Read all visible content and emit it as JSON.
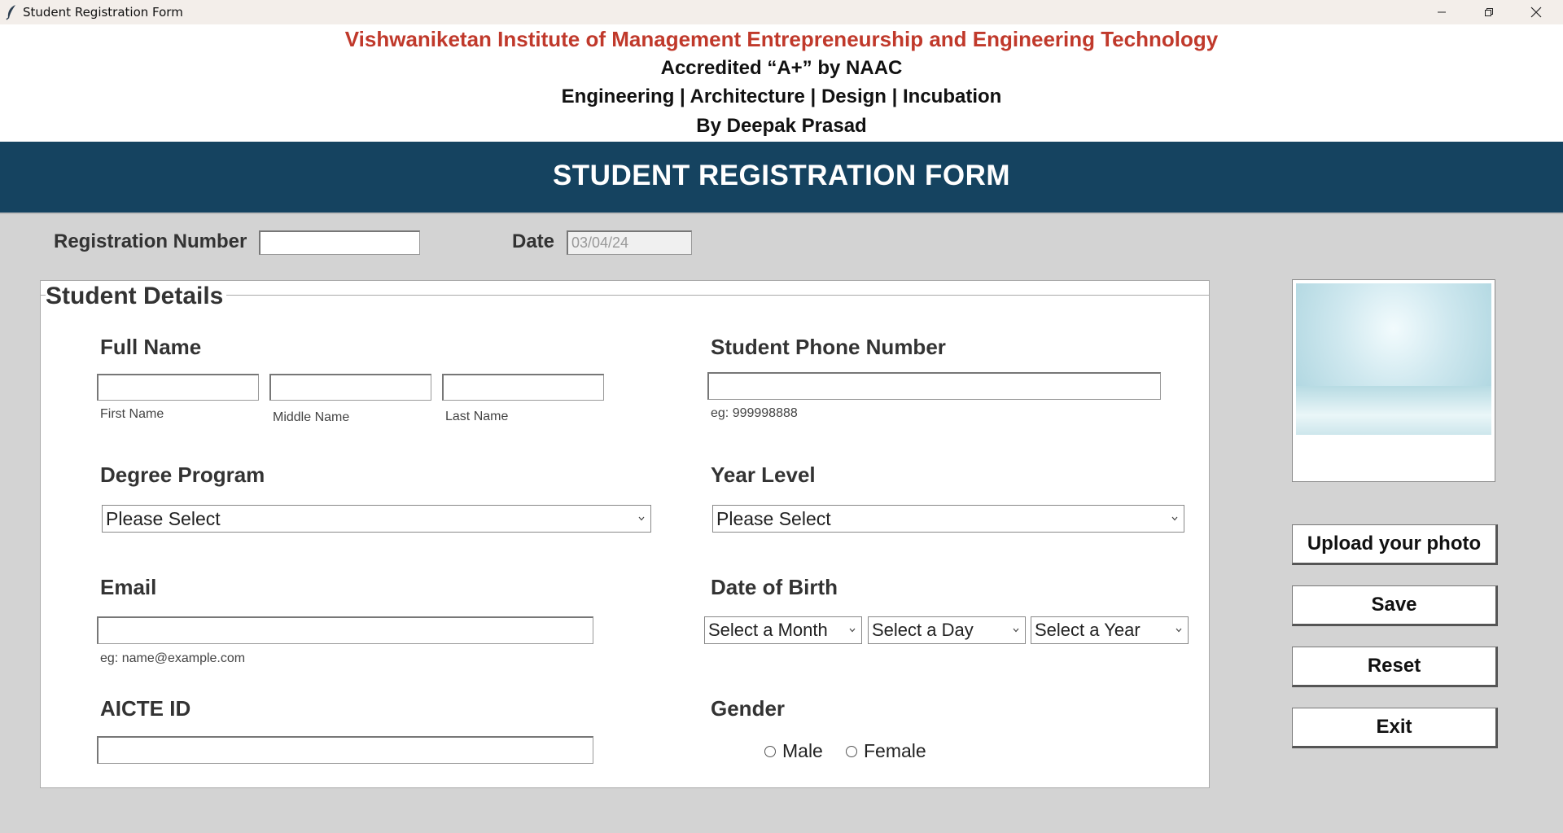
{
  "window": {
    "title": "Student Registration Form"
  },
  "header": {
    "institute": "Vishwaniketan Institute of Management Entrepreneurship and Engineering Technology",
    "accreditation": "Accredited “A+” by NAAC",
    "streams": "Engineering | Architecture | Design | Incubation",
    "author": "By Deepak Prasad",
    "banner": "STUDENT REGISTRATION FORM"
  },
  "top": {
    "reg_label": "Registration Number",
    "reg_value": "",
    "date_label": "Date",
    "date_value": "03/04/24"
  },
  "details": {
    "legend": "Student Details",
    "full_name": {
      "label": "Full Name",
      "first_hint": "First Name",
      "middle_hint": "Middle Name",
      "last_hint": "Last Name"
    },
    "phone": {
      "label": "Student Phone Number",
      "hint": "eg: 999998888"
    },
    "degree": {
      "label": "Degree Program",
      "selected": "Please Select"
    },
    "year": {
      "label": "Year Level",
      "selected": "Please Select"
    },
    "email": {
      "label": "Email",
      "hint": "eg: name@example.com"
    },
    "dob": {
      "label": "Date of Birth",
      "month": "Select a Month",
      "day": "Select a Day",
      "year": "Select a Year"
    },
    "aicte": {
      "label": "AICTE ID"
    },
    "gender": {
      "label": "Gender",
      "male": "Male",
      "female": "Female"
    }
  },
  "buttons": {
    "upload": "Upload your photo",
    "save": "Save",
    "reset": "Reset",
    "exit": "Exit"
  },
  "icons": [
    "feather-icon",
    "minimize-icon",
    "maximize-icon",
    "close-icon",
    "chevron-down-icon"
  ],
  "colors": {
    "institute": "#c0392b",
    "banner": "#154360",
    "body": "#d3d3d3"
  }
}
